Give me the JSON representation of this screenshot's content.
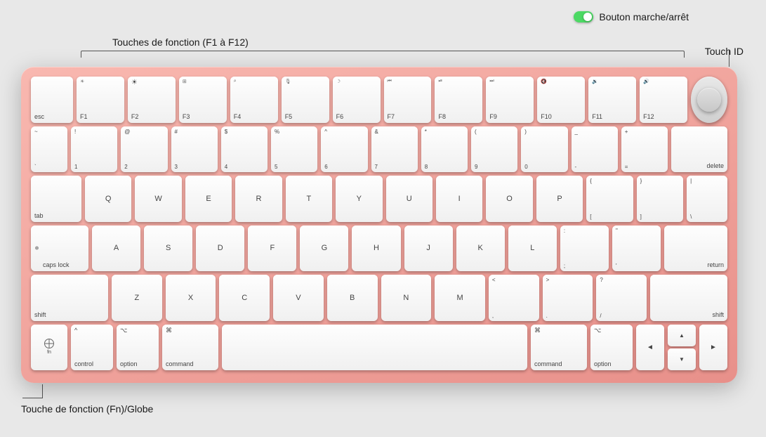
{
  "annotations": {
    "power_label": "Bouton marche/arrêt",
    "touchid_label": "Touch ID",
    "fn_keys_label": "Touches de fonction (F1 à F12)",
    "fn_globe_label": "Touche de fonction (Fn)/Globe"
  },
  "keyboard": {
    "rows": {
      "fn_row": [
        "esc",
        "F1",
        "F2",
        "F3",
        "F4",
        "F5",
        "F6",
        "F7",
        "F8",
        "F9",
        "F10",
        "F11",
        "F12"
      ],
      "num_row": [
        "`~",
        "1!",
        "2@",
        "3#",
        "4$",
        "5%",
        "6^",
        "7&",
        "8*",
        "9(",
        "0)",
        "-_",
        "+=",
        "delete"
      ],
      "qwerty_row": [
        "tab",
        "Q",
        "W",
        "E",
        "R",
        "T",
        "Y",
        "U",
        "I",
        "O",
        "P",
        "[{",
        "]}",
        "\\|"
      ],
      "caps_row": [
        "caps lock",
        "A",
        "S",
        "D",
        "F",
        "G",
        "H",
        "J",
        "K",
        "L",
        ";:",
        "'\"",
        "return"
      ],
      "shift_row": [
        "shift",
        "Z",
        "X",
        "C",
        "V",
        "B",
        "N",
        "M",
        ",<",
        ".>",
        "/?",
        "shift"
      ],
      "bottom_row": [
        "fn",
        "control",
        "option",
        "command",
        "",
        "command",
        "option",
        "◄",
        "▲▼",
        "►"
      ]
    }
  },
  "colors": {
    "keyboard_bg": "#e8908a",
    "key_bg": "#f8f8f8",
    "toggle_on": "#4cd964"
  }
}
